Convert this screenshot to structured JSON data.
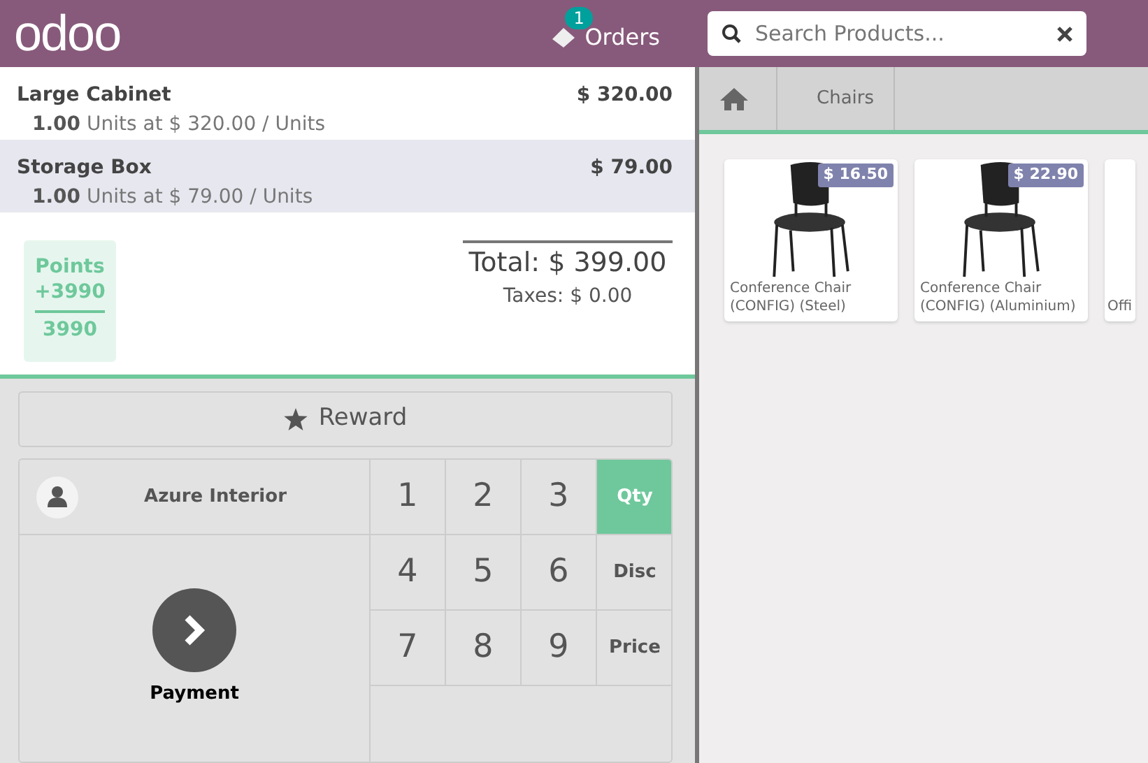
{
  "header": {
    "logo": "odoo",
    "orders_count": "1",
    "orders_label": "Orders",
    "search": {
      "placeholder": "Search Products..."
    }
  },
  "orderlines": [
    {
      "name": "Large Cabinet",
      "price": "$ 320.00",
      "qty": "1.00",
      "detail": "Units at $ 320.00 / Units",
      "selected": false
    },
    {
      "name": "Storage Box",
      "price": "$ 79.00",
      "qty": "1.00",
      "detail": "Units at $ 79.00 / Units",
      "selected": true
    }
  ],
  "points": {
    "label": "Points",
    "won": "+3990",
    "total": "3990"
  },
  "summary": {
    "total": "Total: $ 399.00",
    "taxes": "Taxes: $ 0.00"
  },
  "reward_button": "Reward",
  "customer": "Azure Interior",
  "payment": "Payment",
  "numpad": [
    {
      "key": "1",
      "kind": "digit",
      "selected": false
    },
    {
      "key": "2",
      "kind": "digit",
      "selected": false
    },
    {
      "key": "3",
      "kind": "digit",
      "selected": false
    },
    {
      "key": "Qty",
      "kind": "mode",
      "selected": true
    },
    {
      "key": "4",
      "kind": "digit",
      "selected": false
    },
    {
      "key": "5",
      "kind": "digit",
      "selected": false
    },
    {
      "key": "6",
      "kind": "digit",
      "selected": false
    },
    {
      "key": "Disc",
      "kind": "mode",
      "selected": false
    },
    {
      "key": "7",
      "kind": "digit",
      "selected": false
    },
    {
      "key": "8",
      "kind": "digit",
      "selected": false
    },
    {
      "key": "9",
      "kind": "digit",
      "selected": false
    },
    {
      "key": "Price",
      "kind": "mode",
      "selected": false
    }
  ],
  "breadcrumb": [
    "Chairs"
  ],
  "products": [
    {
      "name": "Conference Chair (CONFIG) (Steel)",
      "price": "$ 16.50"
    },
    {
      "name": "Conference Chair (CONFIG) (Aluminium)",
      "price": "$ 22.90"
    },
    {
      "name": "Offi"
    }
  ]
}
